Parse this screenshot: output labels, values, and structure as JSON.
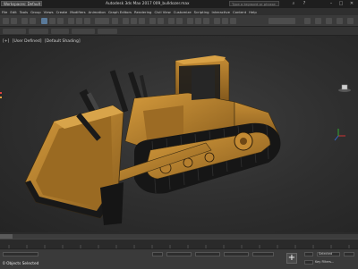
{
  "title_bar": {
    "workspace": "Workspaces: Default",
    "document_title": "Autodesk 3ds Max 2017    009_bulldozer.max",
    "search_placeholder": "Type a keyword or phrase"
  },
  "menu": [
    "File",
    "Edit",
    "Tools",
    "Group",
    "Views",
    "Create",
    "Modifiers",
    "Animation",
    "Graph Editors",
    "Rendering",
    "Civil View",
    "Customize",
    "Scripting",
    "Interactive",
    "Content",
    "Help"
  ],
  "viewport": {
    "label_plus": "[+]",
    "label_view": "[User Defined]",
    "label_shading": "[Default Shading]"
  },
  "status": {
    "objects": "0 Objects Selected",
    "add_key": "+",
    "selected": "Selected",
    "auto_key": "Auto Key",
    "set_key": "Set Key",
    "key_filters": "Key Filters..."
  },
  "colors": {
    "body_yellow": "#b8822c",
    "dark_parts": "#1b1b1b",
    "viewport_bg": "#333333"
  }
}
